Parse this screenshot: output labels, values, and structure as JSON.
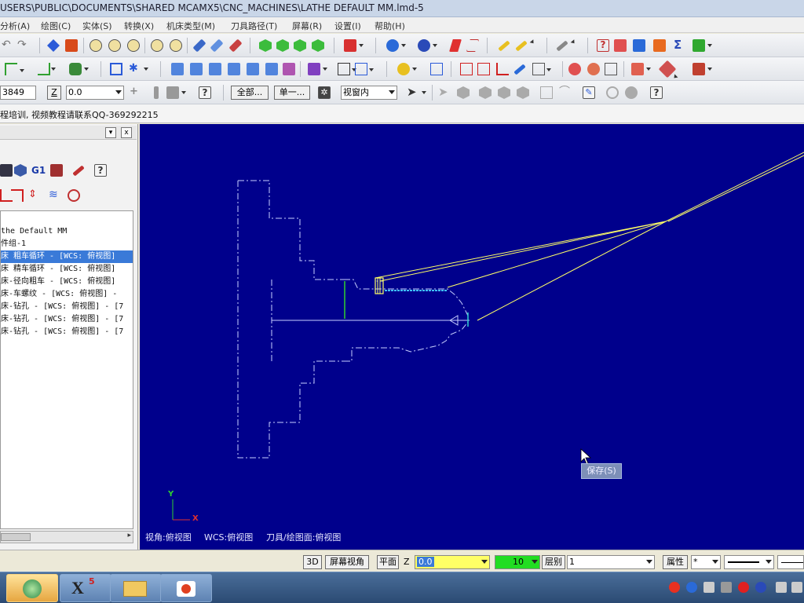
{
  "window": {
    "title": "USERS\\PUBLIC\\DOCUMENTS\\SHARED MCAMX5\\CNC_MACHINES\\LATHE DEFAULT MM.lmd-5"
  },
  "menu": [
    {
      "label": "分析(A)"
    },
    {
      "label": "绘图(C)"
    },
    {
      "label": "实体(S)"
    },
    {
      "label": "转换(X)"
    },
    {
      "label": "机床类型(M)"
    },
    {
      "label": "刀具路径(T)"
    },
    {
      "label": "屏幕(R)"
    },
    {
      "label": "设置(I)"
    },
    {
      "label": "帮助(H)"
    }
  ],
  "toolbar3": {
    "coord_value": "3849",
    "z_label": "Z",
    "z_value": "0.0",
    "all_button": "全部...",
    "single_button": "单一...",
    "view_select": "视窗内"
  },
  "status_text": "程培训, 视频教程请联系QQ-369292215",
  "panel": {
    "g1_label": "G1",
    "minimize_glyph": "▾",
    "close_glyph": "x",
    "tree_items": [
      "the Default MM",
      "件组-1",
      "床 粗车循环 - [WCS: 俯视图]",
      "床 精车循环 - [WCS: 俯视图]",
      "床-径向粗车 - [WCS: 俯视图]",
      "床-车螺纹 - [WCS: 俯视图] -",
      "床-钻孔 - [WCS: 俯视图] - [7",
      "床-钻孔 - [WCS: 俯视图] - [7",
      "床-钻孔 - [WCS: 俯视图] - [7"
    ],
    "selected_index": 2
  },
  "viewport": {
    "axis_y": "Y",
    "axis_x": "X",
    "view_status": "视角:俯视图",
    "wcs_status": "WCS:俯视图",
    "tool_plane_status": "刀具/绘图面:俯视图",
    "tooltip": "保存(S)"
  },
  "bottombar": {
    "btn_3d": "3D",
    "btn_screen_view": "屏幕视角",
    "btn_plane": "平面",
    "z_label": "Z",
    "z_value": "0.0",
    "color_value": "10",
    "level_label": "层别",
    "level_value": "1",
    "attr_button": "属性",
    "point_style": "*"
  },
  "colors": {
    "viewport_bg": "#00008c",
    "z_field_bg": "#ffff66",
    "color_field_bg": "#22dd22",
    "toolpath_yellow": "#ffff66"
  }
}
